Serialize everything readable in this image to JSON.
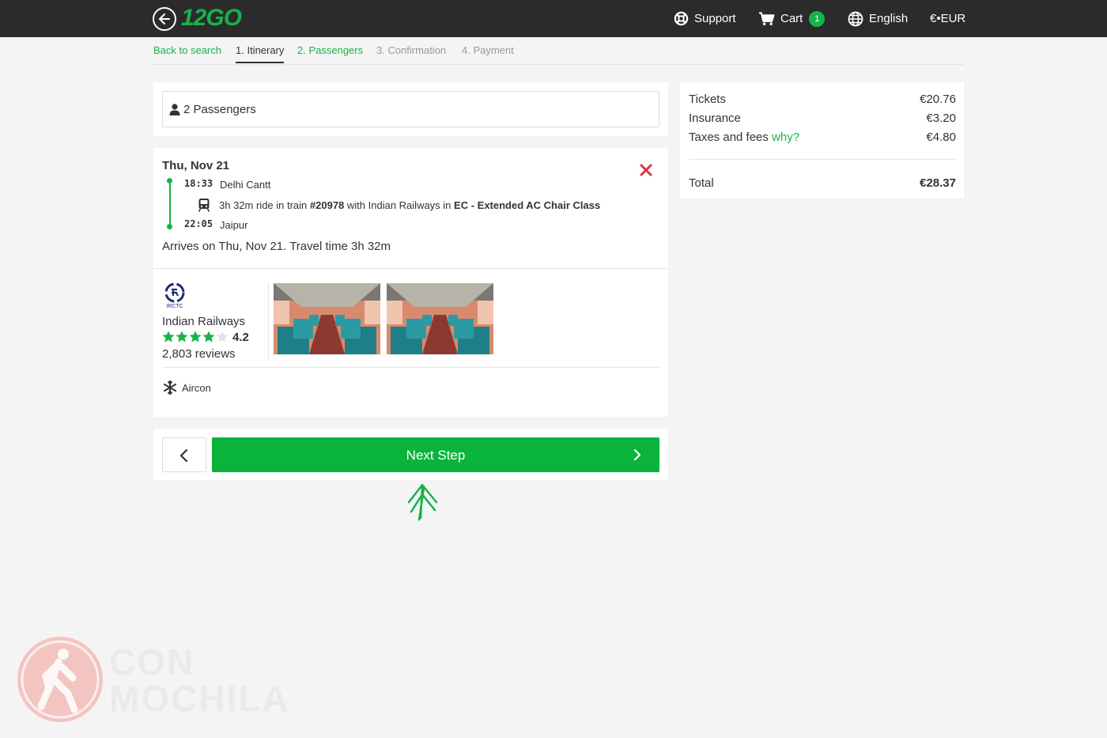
{
  "header": {
    "logo_text": "12GO",
    "support_label": "Support",
    "cart_label": "Cart",
    "cart_count": "1",
    "language_label": "English",
    "currency_label": "€•EUR"
  },
  "steps": {
    "back_label": "Back to search",
    "items": [
      "1. Itinerary",
      "2. Passengers",
      "3. Confirmation",
      "4. Payment"
    ]
  },
  "passengers": {
    "label": "2 Passengers"
  },
  "trip": {
    "date": "Thu, Nov 21",
    "depart_time": "18:33",
    "depart_station": "Delhi Cantt",
    "ride_prefix": "3h 32m ride in train ",
    "train_number": "#20978",
    "ride_mid": " with Indian Railways in ",
    "class_name": "EC - Extended AC Chair Class",
    "arrive_time": "22:05",
    "arrive_station": "Jaipur",
    "arrives_text": "Arrives on Thu, Nov 21. Travel time 3h 32m"
  },
  "operator": {
    "logo_caption": "IRCTC",
    "name": "Indian Railways",
    "rating": "4.2",
    "stars_filled": 4,
    "stars_total": 5,
    "reviews": "2,803 reviews"
  },
  "amenities": [
    "Aircon"
  ],
  "actions": {
    "next_label": "Next Step"
  },
  "summary": {
    "rows": [
      {
        "label": "Tickets",
        "value": "€20.76"
      },
      {
        "label": "Insurance",
        "value": "€3.20"
      },
      {
        "label": "Taxes and fees",
        "link": "why?",
        "value": "€4.80"
      }
    ],
    "total_label": "Total",
    "total_value": "€28.37"
  },
  "watermark": {
    "line1": "CON",
    "line2": "MOCHILA"
  },
  "colors": {
    "brand_green": "#0ab43c",
    "topbar": "#2b2b2b",
    "remove_red": "#d9363e"
  }
}
